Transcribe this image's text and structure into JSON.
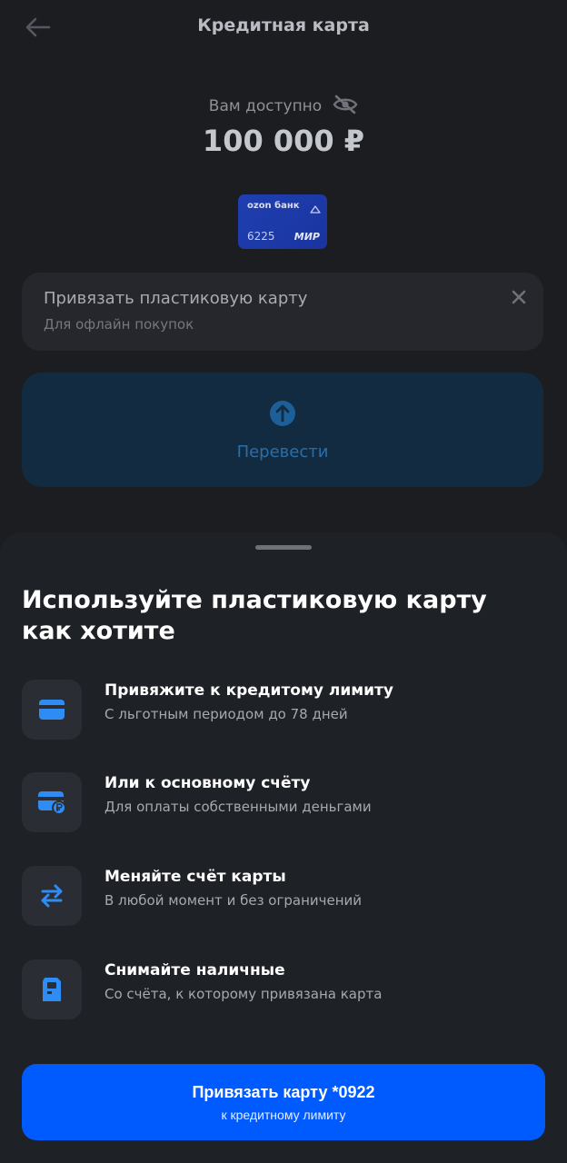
{
  "header": {
    "title": "Кредитная карта"
  },
  "balance": {
    "label": "Вам доступно",
    "amount": "100 000 ₽"
  },
  "card": {
    "bank_name": "ozon банк",
    "last_digits": "6225",
    "payment_system": "МИР"
  },
  "promo": {
    "title": "Привязать пластиковую карту",
    "subtitle": "Для офлайн покупок"
  },
  "transfer": {
    "label": "Перевести"
  },
  "sheet": {
    "title": "Используйте пластиковую карту как хотите",
    "features": [
      {
        "title": "Привяжите к кредитому лимиту",
        "subtitle": "С льготным периодом до 78 дней",
        "icon": "card-icon"
      },
      {
        "title": "Или к основному счёту",
        "subtitle": "Для оплаты собственными деньгами",
        "icon": "card-ruble-icon"
      },
      {
        "title": "Меняйте счёт карты",
        "subtitle": "В любой момент и без ограничений",
        "icon": "swap-arrows-icon"
      },
      {
        "title": "Снимайте наличные",
        "subtitle": "Со счёта, к которому привязана карта",
        "icon": "atm-icon"
      }
    ],
    "cta": {
      "title": "Привязать карту *0922",
      "subtitle": "к кредитному лимиту"
    }
  },
  "colors": {
    "accent": "#005bff",
    "icon_blue": "#2f8cf5",
    "sheet_bg": "#1e2126"
  }
}
